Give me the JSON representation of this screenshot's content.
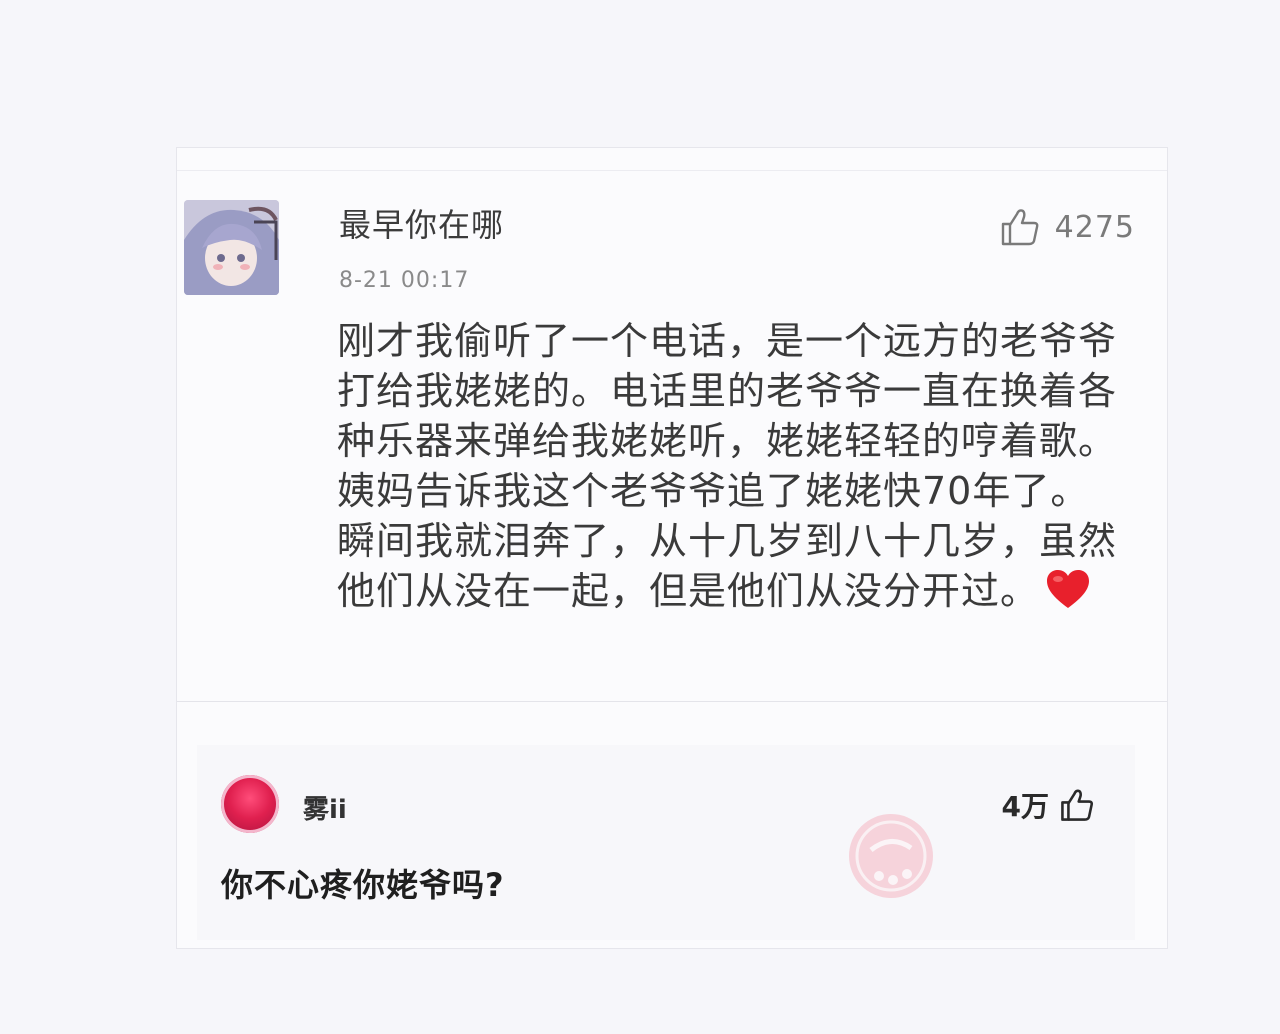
{
  "comment": {
    "username": "最早你在哪",
    "timestamp": "8-21 00:17",
    "like_count": "4275",
    "body": "刚才我偷听了一个电话，是一个远方的老爷爷打给我姥姥的。电话里的老爷爷一直在换着各种乐器来弹给我姥姥听，姥姥轻轻的哼着歌。姨妈告诉我这个老爷爷追了姥姥快70年了。瞬间我就泪奔了，从十几岁到八十几岁，虽然他们从没在一起，但是他们从没分开过。",
    "emoji": "heart-icon"
  },
  "reply": {
    "username": "雾ii",
    "like_count": "4万",
    "text": "你不心疼你姥爷吗?"
  },
  "colors": {
    "page_bg": "#f6f6fa",
    "card_bg": "#fbfbfd",
    "heart": "#e8202c",
    "stamp": "#f2a3b2"
  }
}
